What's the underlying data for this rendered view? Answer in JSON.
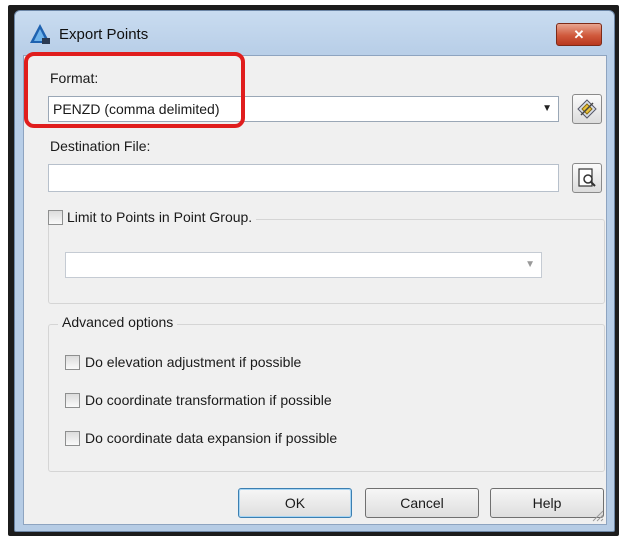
{
  "window": {
    "title": "Export Points",
    "close_glyph": "✕"
  },
  "format": {
    "label": "Format:",
    "selected": "PENZD (comma delimited)"
  },
  "destination": {
    "label": "Destination File:",
    "value": ""
  },
  "limit_group": {
    "label": "Limit to Points in Point Group.",
    "checked": false,
    "selected": ""
  },
  "advanced": {
    "label": "Advanced options",
    "options": [
      {
        "label": "Do elevation adjustment if possible",
        "checked": false
      },
      {
        "label": "Do coordinate transformation if possible",
        "checked": false
      },
      {
        "label": "Do coordinate data expansion if possible",
        "checked": false
      }
    ]
  },
  "buttons": {
    "ok": "OK",
    "cancel": "Cancel",
    "help": "Help"
  },
  "colors": {
    "highlight": "#e01d1d",
    "title_bar": "#c9dcf0",
    "close_button": "#d0593c"
  },
  "icons": [
    "app-icon",
    "close-icon",
    "format-settings-icon",
    "browse-file-icon",
    "resize-grip-icon"
  ]
}
